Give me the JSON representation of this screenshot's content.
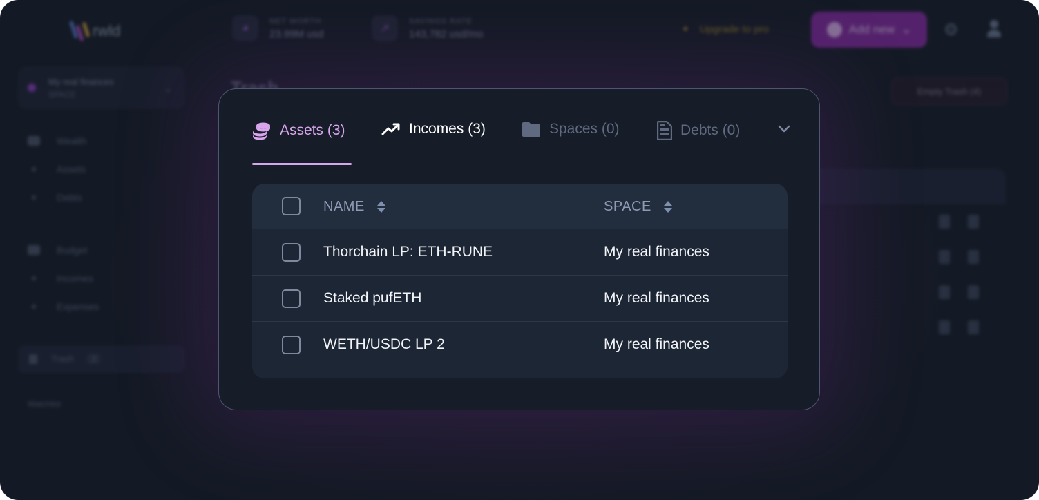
{
  "background": {
    "logo_text": "rwld",
    "stats": [
      {
        "label": "NET WORTH",
        "value": "23.99M usd"
      },
      {
        "label": "SAVINGS RATE",
        "value": "143,782 usd/mo"
      }
    ],
    "upgrade_label": "Upgrade to pro",
    "add_new_label": "Add new",
    "space": {
      "name": "My real finances",
      "sub": "SPACE"
    },
    "nav": {
      "wealth": "Wealth",
      "assets": "Assets",
      "debts": "Debts",
      "budget": "Budget",
      "incomes": "Incomes",
      "expenses": "Expenses",
      "trash": "Trash",
      "trash_count": "3",
      "watchlist": "Watchlist"
    },
    "page_title": "Trash",
    "empty_trash_label": "Empty Trash (4)"
  },
  "modal": {
    "tabs": [
      {
        "label": "Assets (3)",
        "icon": "coins-icon",
        "state": "active"
      },
      {
        "label": "Incomes (3)",
        "icon": "trending-up-icon",
        "state": "normal"
      },
      {
        "label": "Spaces (0)",
        "icon": "folder-icon",
        "state": "disabled"
      },
      {
        "label": "Debts (0)",
        "icon": "document-icon",
        "state": "disabled"
      }
    ],
    "table": {
      "columns": [
        "NAME",
        "SPACE"
      ],
      "rows": [
        {
          "name": "Thorchain LP: ETH-RUNE",
          "space": "My real finances"
        },
        {
          "name": "Staked pufETH",
          "space": "My real finances"
        },
        {
          "name": "WETH/USDC LP 2",
          "space": "My real finances"
        }
      ]
    }
  },
  "colors": {
    "accent": "#d7a6ec",
    "brand": "#8a2aa6",
    "modal_bg": "#161d28",
    "table_bg": "#1d2635"
  }
}
